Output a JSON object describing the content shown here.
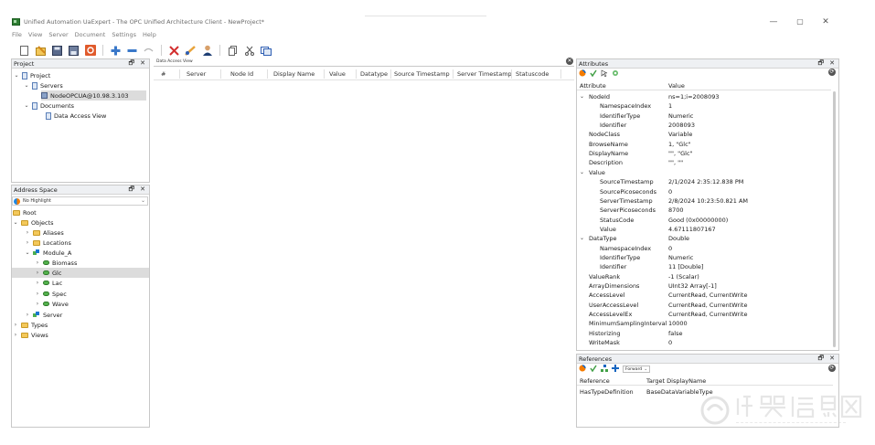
{
  "window": {
    "title": "Unified Automation UaExpert - The OPC Unified Architecture Client - NewProject*",
    "minimize": "—",
    "maximize": "▢",
    "close": "✕"
  },
  "menu": [
    "File",
    "View",
    "Server",
    "Document",
    "Settings",
    "Help"
  ],
  "toolbar": {
    "icons": [
      "new-project-icon",
      "open-project-icon",
      "save-project-icon",
      "save-as-icon",
      "settings-icon",
      "add-server-icon",
      "remove-server-icon",
      "connect-icon",
      "disconnect-icon",
      "add-document-icon",
      "user-icon",
      "copy-icon",
      "cut-icon",
      "paste-icon"
    ]
  },
  "project_panel": {
    "title": "Project",
    "pin": "🗗",
    "close": "✕",
    "tree": [
      {
        "label": "Project",
        "depth": 0,
        "expanded": true
      },
      {
        "label": "Servers",
        "depth": 1,
        "expanded": true
      },
      {
        "label": "NodeOPCUA@10.98.3.103",
        "depth": 2,
        "selected": true
      },
      {
        "label": "Documents",
        "depth": 1,
        "expanded": true
      },
      {
        "label": "Data Access View",
        "depth": 2
      }
    ]
  },
  "address_panel": {
    "title": "Address Space",
    "pin": "🗗",
    "close": "✕",
    "combo_value": "No Highlight",
    "tree": [
      {
        "label": "Root",
        "depth": 0
      },
      {
        "label": "Objects",
        "depth": 1,
        "expanded": true
      },
      {
        "label": "Aliases",
        "depth": 2
      },
      {
        "label": "Locations",
        "depth": 2
      },
      {
        "label": "Module_A",
        "depth": 2,
        "expanded": true
      },
      {
        "label": "Biomass",
        "depth": 3
      },
      {
        "label": "Glc",
        "depth": 3,
        "selected": true
      },
      {
        "label": "Lac",
        "depth": 3
      },
      {
        "label": "Spec",
        "depth": 3
      },
      {
        "label": "Wave",
        "depth": 3
      },
      {
        "label": "Server",
        "depth": 2
      },
      {
        "label": "Types",
        "depth": 1
      },
      {
        "label": "Views",
        "depth": 1
      }
    ]
  },
  "data_access_view": {
    "tab_label": "Data Access View",
    "close": "✕",
    "columns": [
      "#",
      "Server",
      "Node Id",
      "Display Name",
      "Value",
      "Datatype",
      "Source Timestamp",
      "Server Timestamp",
      "Statuscode"
    ]
  },
  "attributes_panel": {
    "title": "Attributes",
    "pin": "🗗",
    "close": "✕",
    "refresh": "⟳",
    "col_attribute": "Attribute",
    "col_value": "Value",
    "rows": [
      {
        "name": "NodeId",
        "value": "ns=1;i=2008093",
        "depth": 0,
        "group": true
      },
      {
        "name": "NamespaceIndex",
        "value": "1",
        "depth": 1
      },
      {
        "name": "IdentifierType",
        "value": "Numeric",
        "depth": 1
      },
      {
        "name": "Identifier",
        "value": "2008093",
        "depth": 1
      },
      {
        "name": "NodeClass",
        "value": "Variable",
        "depth": 0
      },
      {
        "name": "BrowseName",
        "value": "1, \"Glc\"",
        "depth": 0
      },
      {
        "name": "DisplayName",
        "value": "\"\", \"Glc\"",
        "depth": 0
      },
      {
        "name": "Description",
        "value": "\"\", \"\"",
        "depth": 0
      },
      {
        "name": "Value",
        "value": "",
        "depth": 0,
        "group": true
      },
      {
        "name": "SourceTimestamp",
        "value": "2/1/2024 2:35:12.838 PM",
        "depth": 1
      },
      {
        "name": "SourcePicoseconds",
        "value": "0",
        "depth": 1
      },
      {
        "name": "ServerTimestamp",
        "value": "2/8/2024 10:23:50.821 AM",
        "depth": 1
      },
      {
        "name": "ServerPicoseconds",
        "value": "8700",
        "depth": 1
      },
      {
        "name": "StatusCode",
        "value": "Good (0x00000000)",
        "depth": 1
      },
      {
        "name": "Value",
        "value": "4.67111807167",
        "depth": 1
      },
      {
        "name": "DataType",
        "value": "Double",
        "depth": 0,
        "group": true
      },
      {
        "name": "NamespaceIndex",
        "value": "0",
        "depth": 1
      },
      {
        "name": "IdentifierType",
        "value": "Numeric",
        "depth": 1
      },
      {
        "name": "Identifier",
        "value": "11 [Double]",
        "depth": 1
      },
      {
        "name": "ValueRank",
        "value": "-1 (Scalar)",
        "depth": 0
      },
      {
        "name": "ArrayDimensions",
        "value": "UInt32 Array[-1]",
        "depth": 0
      },
      {
        "name": "AccessLevel",
        "value": "CurrentRead, CurrentWrite",
        "depth": 0
      },
      {
        "name": "UserAccessLevel",
        "value": "CurrentRead, CurrentWrite",
        "depth": 0
      },
      {
        "name": "AccessLevelEx",
        "value": "CurrentRead, CurrentWrite",
        "depth": 0
      },
      {
        "name": "MinimumSamplingInterval",
        "value": "10000",
        "depth": 0
      },
      {
        "name": "Historizing",
        "value": "false",
        "depth": 0
      },
      {
        "name": "WriteMask",
        "value": "0",
        "depth": 0
      }
    ]
  },
  "references_panel": {
    "title": "References",
    "pin": "🗗",
    "close": "✕",
    "refresh": "⟳",
    "direction": "Forward",
    "col_reference": "Reference",
    "col_target": "Target DisplayName",
    "rows": [
      {
        "reference": "HasTypeDefinition",
        "target": "BaseDataVariableType"
      }
    ]
  },
  "watermark": {
    "logo": "仪器信息网",
    "url": "www.instrument.com.cn"
  }
}
